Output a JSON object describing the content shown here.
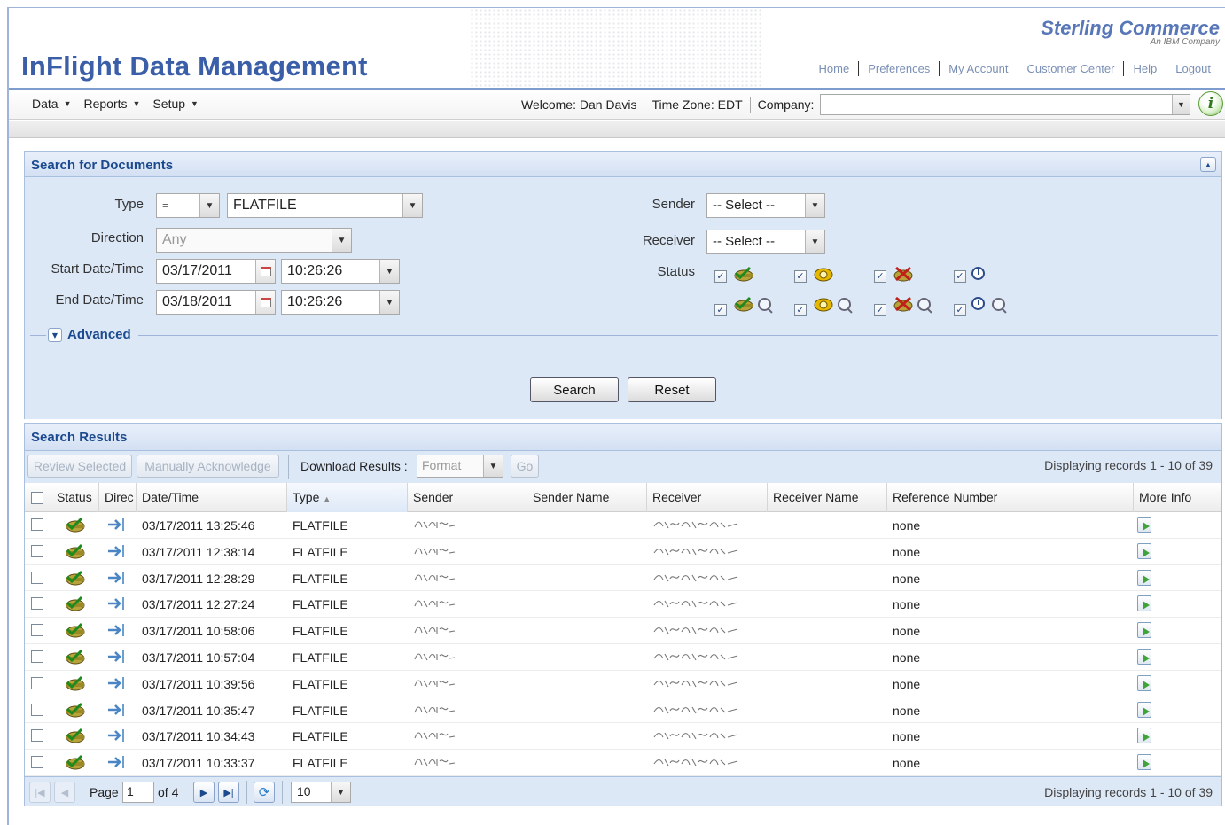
{
  "header": {
    "app_title": "InFlight Data Management",
    "brand_name": "Sterling Commerce",
    "brand_sub": "An IBM Company",
    "links": [
      "Home",
      "Preferences",
      "My Account",
      "Customer Center",
      "Help",
      "Logout"
    ]
  },
  "menubar": {
    "items": [
      "Data",
      "Reports",
      "Setup"
    ],
    "welcome": "Welcome: Dan Davis",
    "timezone": "Time Zone: EDT",
    "company_label": "Company:",
    "company_value": ""
  },
  "search": {
    "panel_title": "Search for Documents",
    "type_label": "Type",
    "type_operator": "=",
    "type_value": "FLATFILE",
    "direction_label": "Direction",
    "direction_value": "Any",
    "start_label": "Start Date/Time",
    "start_date": "03/17/2011",
    "start_time": "10:26:26",
    "end_label": "End Date/Time",
    "end_date": "03/18/2011",
    "end_time": "10:26:26",
    "sender_label": "Sender",
    "sender_value": "-- Select --",
    "receiver_label": "Receiver",
    "receiver_value": "-- Select --",
    "status_label": "Status",
    "advanced_label": "Advanced",
    "search_button": "Search",
    "reset_button": "Reset"
  },
  "results": {
    "panel_title": "Search Results",
    "review_selected": "Review Selected",
    "manually_acknowledge": "Manually Acknowledge",
    "download_label": "Download Results :",
    "format_placeholder": "Format",
    "go_button": "Go",
    "displaying": "Displaying records 1 - 10 of 39",
    "columns": [
      "Status",
      "Direc",
      "Date/Time",
      "Type",
      "Sender",
      "Sender Name",
      "Receiver",
      "Receiver Name",
      "Reference Number",
      "More Info"
    ],
    "rows": [
      {
        "datetime": "03/17/2011 13:25:46",
        "type": "FLATFILE",
        "reference": "none"
      },
      {
        "datetime": "03/17/2011 12:38:14",
        "type": "FLATFILE",
        "reference": "none"
      },
      {
        "datetime": "03/17/2011 12:28:29",
        "type": "FLATFILE",
        "reference": "none"
      },
      {
        "datetime": "03/17/2011 12:27:24",
        "type": "FLATFILE",
        "reference": "none"
      },
      {
        "datetime": "03/17/2011 10:58:06",
        "type": "FLATFILE",
        "reference": "none"
      },
      {
        "datetime": "03/17/2011 10:57:04",
        "type": "FLATFILE",
        "reference": "none"
      },
      {
        "datetime": "03/17/2011 10:39:56",
        "type": "FLATFILE",
        "reference": "none"
      },
      {
        "datetime": "03/17/2011 10:35:47",
        "type": "FLATFILE",
        "reference": "none"
      },
      {
        "datetime": "03/17/2011 10:34:43",
        "type": "FLATFILE",
        "reference": "none"
      },
      {
        "datetime": "03/17/2011 10:33:37",
        "type": "FLATFILE",
        "reference": "none"
      }
    ]
  },
  "pager": {
    "page_label": "Page",
    "page_value": "1",
    "of_label": "of 4",
    "page_size": "10",
    "displaying": "Displaying records 1 - 10 of 39"
  },
  "colors": {
    "accent": "#3b5ea8",
    "panel_bg": "#dde8f7",
    "panel_title": "#1b4a8e"
  }
}
